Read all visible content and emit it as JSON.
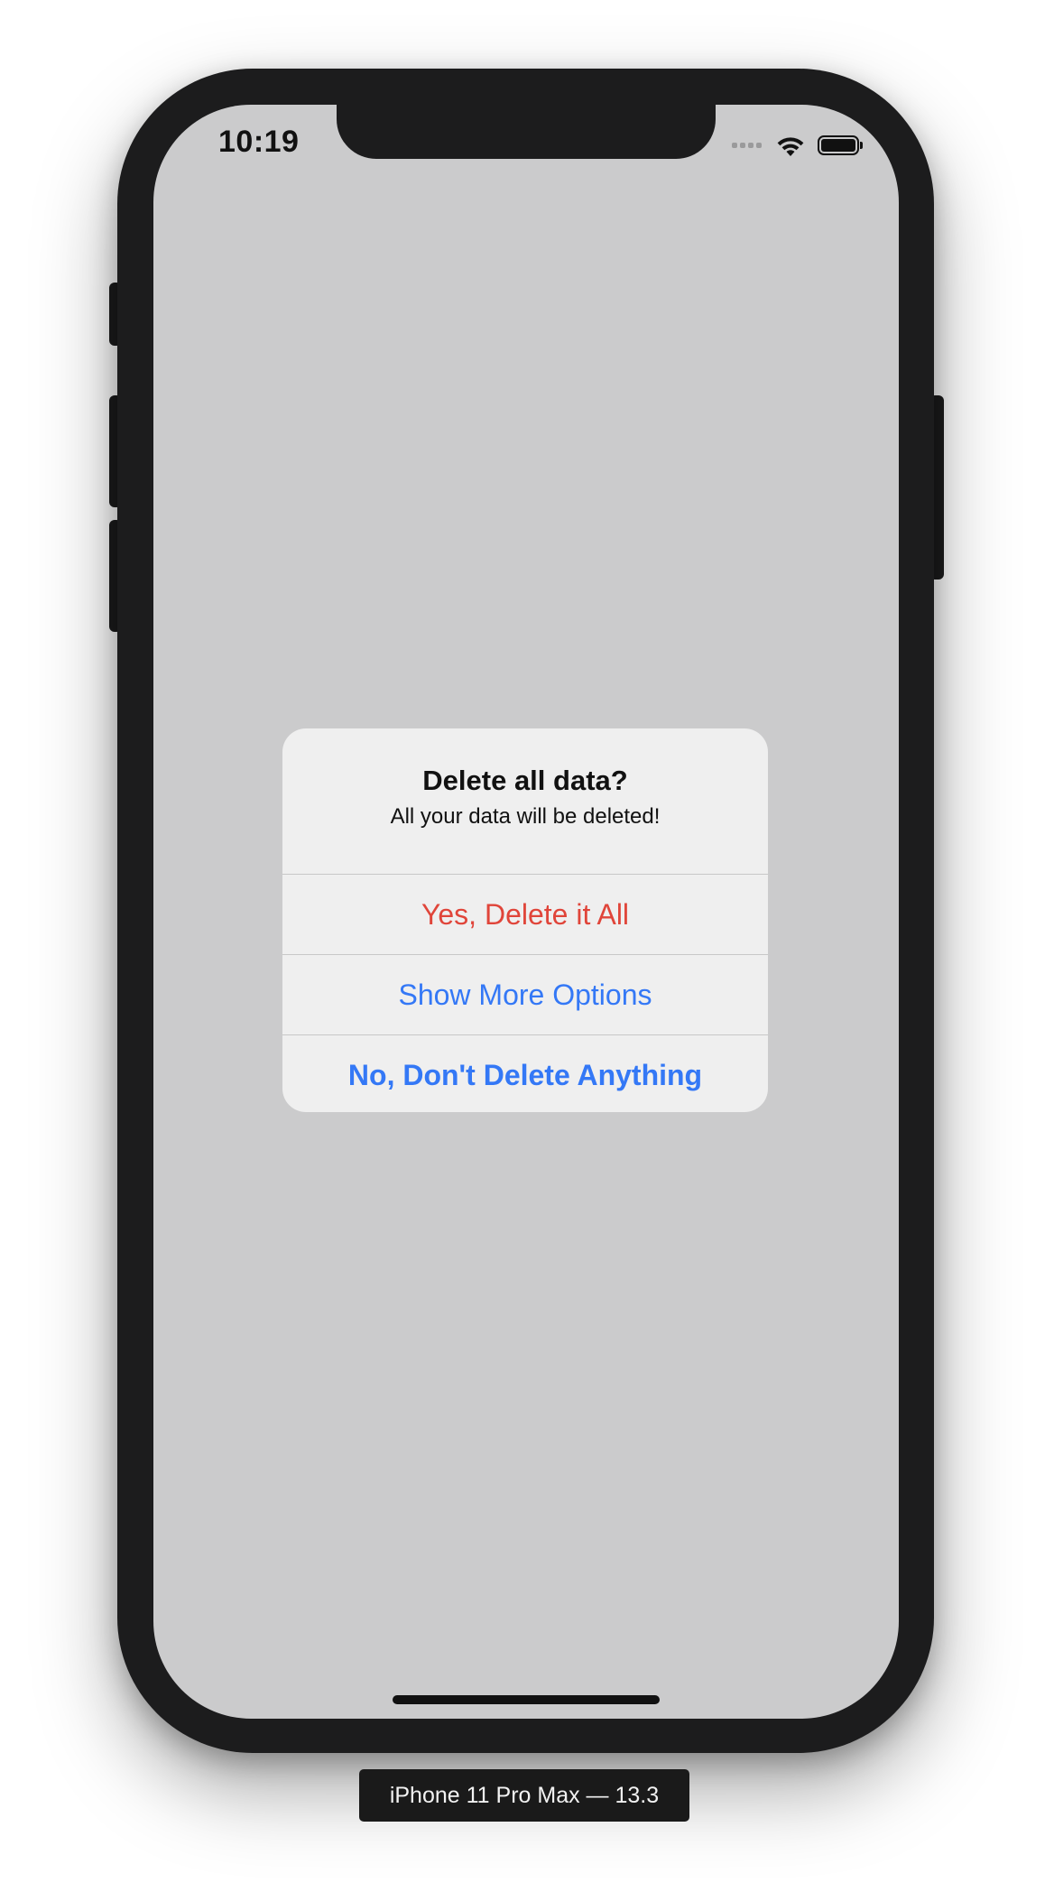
{
  "status_bar": {
    "time": "10:19",
    "icons": [
      "signal-icon",
      "wifi-icon",
      "battery-icon"
    ]
  },
  "alert": {
    "title": "Delete all data?",
    "message": "All your data will be deleted!",
    "actions": [
      {
        "label": "Yes, Delete it All",
        "style": "destructive",
        "color": "#e0453a"
      },
      {
        "label": "Show More Options",
        "style": "default",
        "color": "#3478f6"
      },
      {
        "label": "No, Don't Delete Anything",
        "style": "preferred",
        "color": "#3478f6"
      }
    ]
  },
  "device": {
    "label": "iPhone 11 Pro Max — 13.3"
  },
  "colors": {
    "screen_background": "#cbcbcc",
    "alert_background": "#efefef",
    "device_frame": "#1c1c1d"
  }
}
